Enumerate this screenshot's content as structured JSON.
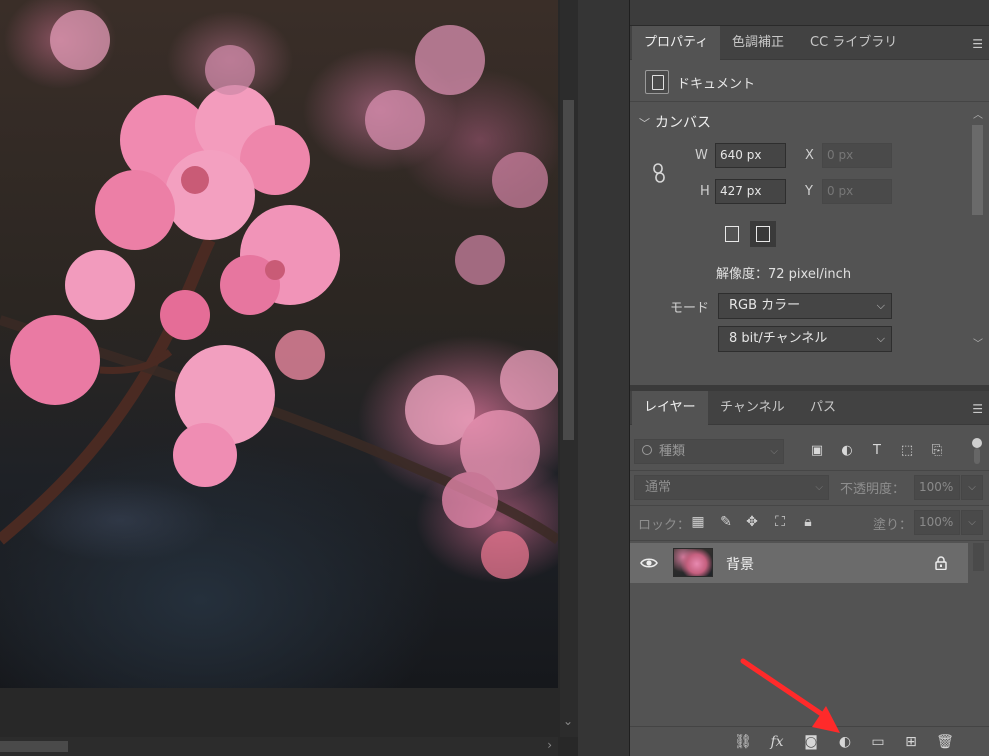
{
  "properties_panel": {
    "tabs": [
      {
        "label": "プロパティ",
        "active": true
      },
      {
        "label": "色調補正",
        "active": false
      },
      {
        "label": "CC ライブラリ",
        "active": false
      }
    ],
    "menu_icon": "panel-menu-icon",
    "document_label": "ドキュメント",
    "canvas": {
      "section_title": "カンバス",
      "width_label": "W",
      "width_value": "640 px",
      "height_label": "H",
      "height_value": "427 px",
      "x_label": "X",
      "x_placeholder": "0 px",
      "y_label": "Y",
      "y_placeholder": "0 px",
      "resolution": "解像度：72 pixel/inch",
      "mode_label": "モード",
      "mode_value": "RGB カラー",
      "depth_value": "8 bit/チャンネル"
    }
  },
  "layers_panel": {
    "tabs": [
      {
        "label": "レイヤー",
        "active": true
      },
      {
        "label": "チャンネル",
        "active": false
      },
      {
        "label": "パス",
        "active": false
      }
    ],
    "filter_placeholder": "種類",
    "blend_mode": "通常",
    "opacity_label": "不透明度：",
    "opacity_value": "100%",
    "lock_label": "ロック：",
    "fill_label": "塗り：",
    "fill_value": "100%",
    "layers": [
      {
        "name": "背景",
        "visible": true,
        "locked": true
      }
    ]
  },
  "colors": {
    "panel_bg": "#535353",
    "tab_bar": "#424242",
    "selected_layer": "#6b6b6b",
    "annotation_arrow": "#ff2a2a"
  }
}
